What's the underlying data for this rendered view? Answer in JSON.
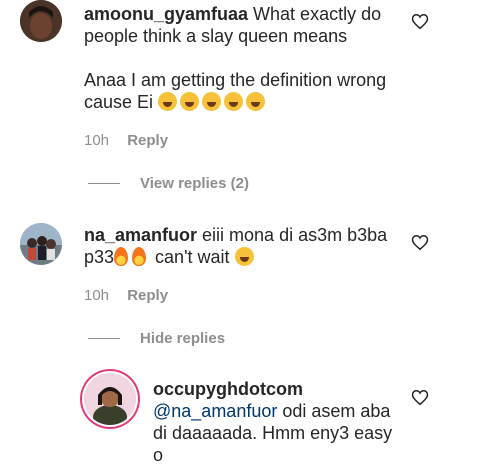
{
  "comments": [
    {
      "username": "amoonu_gyamfuaa",
      "text_line1": " What exactly do",
      "text_line2": "people think a slay queen means",
      "text_line3": "Anaa I am getting the definition wrong",
      "text_line4": "cause Ei",
      "emoji_count": 5,
      "time": "10h",
      "reply_label": "Reply",
      "view_replies": "View replies (2)"
    },
    {
      "username": "na_amanfuor",
      "text_line1": " eiii mona di as3m b3ba",
      "text_line2_pre": "p33",
      "text_line2_post": " can't wait ",
      "time": "10h",
      "reply_label": "Reply",
      "hide_replies": "Hide replies"
    }
  ],
  "reply": {
    "username": "occupyghdotcom",
    "mention": "@na_amanfuor",
    "text_line1": " odi asem aba",
    "text_line2": "di daaaaada. Hmm eny3 easy",
    "text_line3": "o"
  },
  "icons": {
    "like": "heart-outline-icon"
  },
  "colors": {
    "text": "#262626",
    "meta": "#8e8e8e",
    "mention": "#00376b",
    "story_ring": "#e23b7a"
  }
}
